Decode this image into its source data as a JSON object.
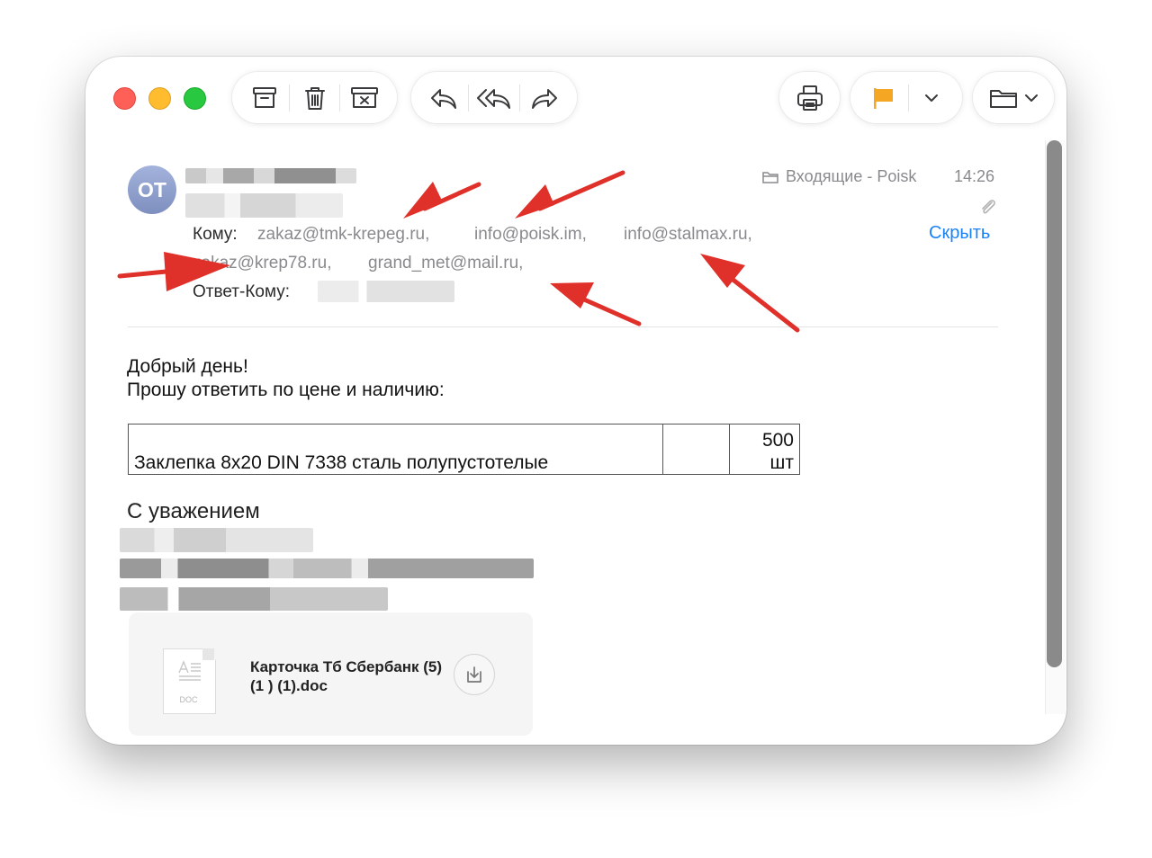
{
  "toolbar": {
    "archive_icon": "archive-box-icon",
    "delete_icon": "trash-icon",
    "junk_icon": "junk-box-icon",
    "reply_icon": "reply-arrow-icon",
    "reply_all_icon": "reply-all-arrow-icon",
    "forward_icon": "forward-arrow-icon",
    "print_icon": "printer-icon",
    "flag_icon": "flag-icon",
    "flag_color": "#f5a623",
    "move_icon": "folder-icon"
  },
  "message": {
    "avatar_initials": "OT",
    "mailbox": "Входящие - Poisk",
    "time": "14:26",
    "to_label": "Кому:",
    "recipients": [
      "zakaz@tmk-krepeg.ru,",
      "info@poisk.im,",
      "info@stalmax.ru,",
      "zakaz@krep78.ru,",
      "grand_met@mail.ru,"
    ],
    "reply_to_label": "Ответ-Кому:",
    "hide_label": "Скрыть",
    "accent_color": "#1a82f7"
  },
  "body": {
    "greeting": "Добрый день!",
    "request": "Прошу ответить по цене и наличию:",
    "table": [
      {
        "item": "Заклепка 8x20 DIN 7338 сталь полупустотелые",
        "price": "",
        "qty": "500",
        "unit": "шт"
      }
    ],
    "signature": "С уважением"
  },
  "attachment": {
    "name": "Карточка Тб Сбербанк (5) (1 ) (1).doc",
    "type_label": "DOC"
  },
  "annotation": {
    "arrow_color": "#e0302a"
  }
}
